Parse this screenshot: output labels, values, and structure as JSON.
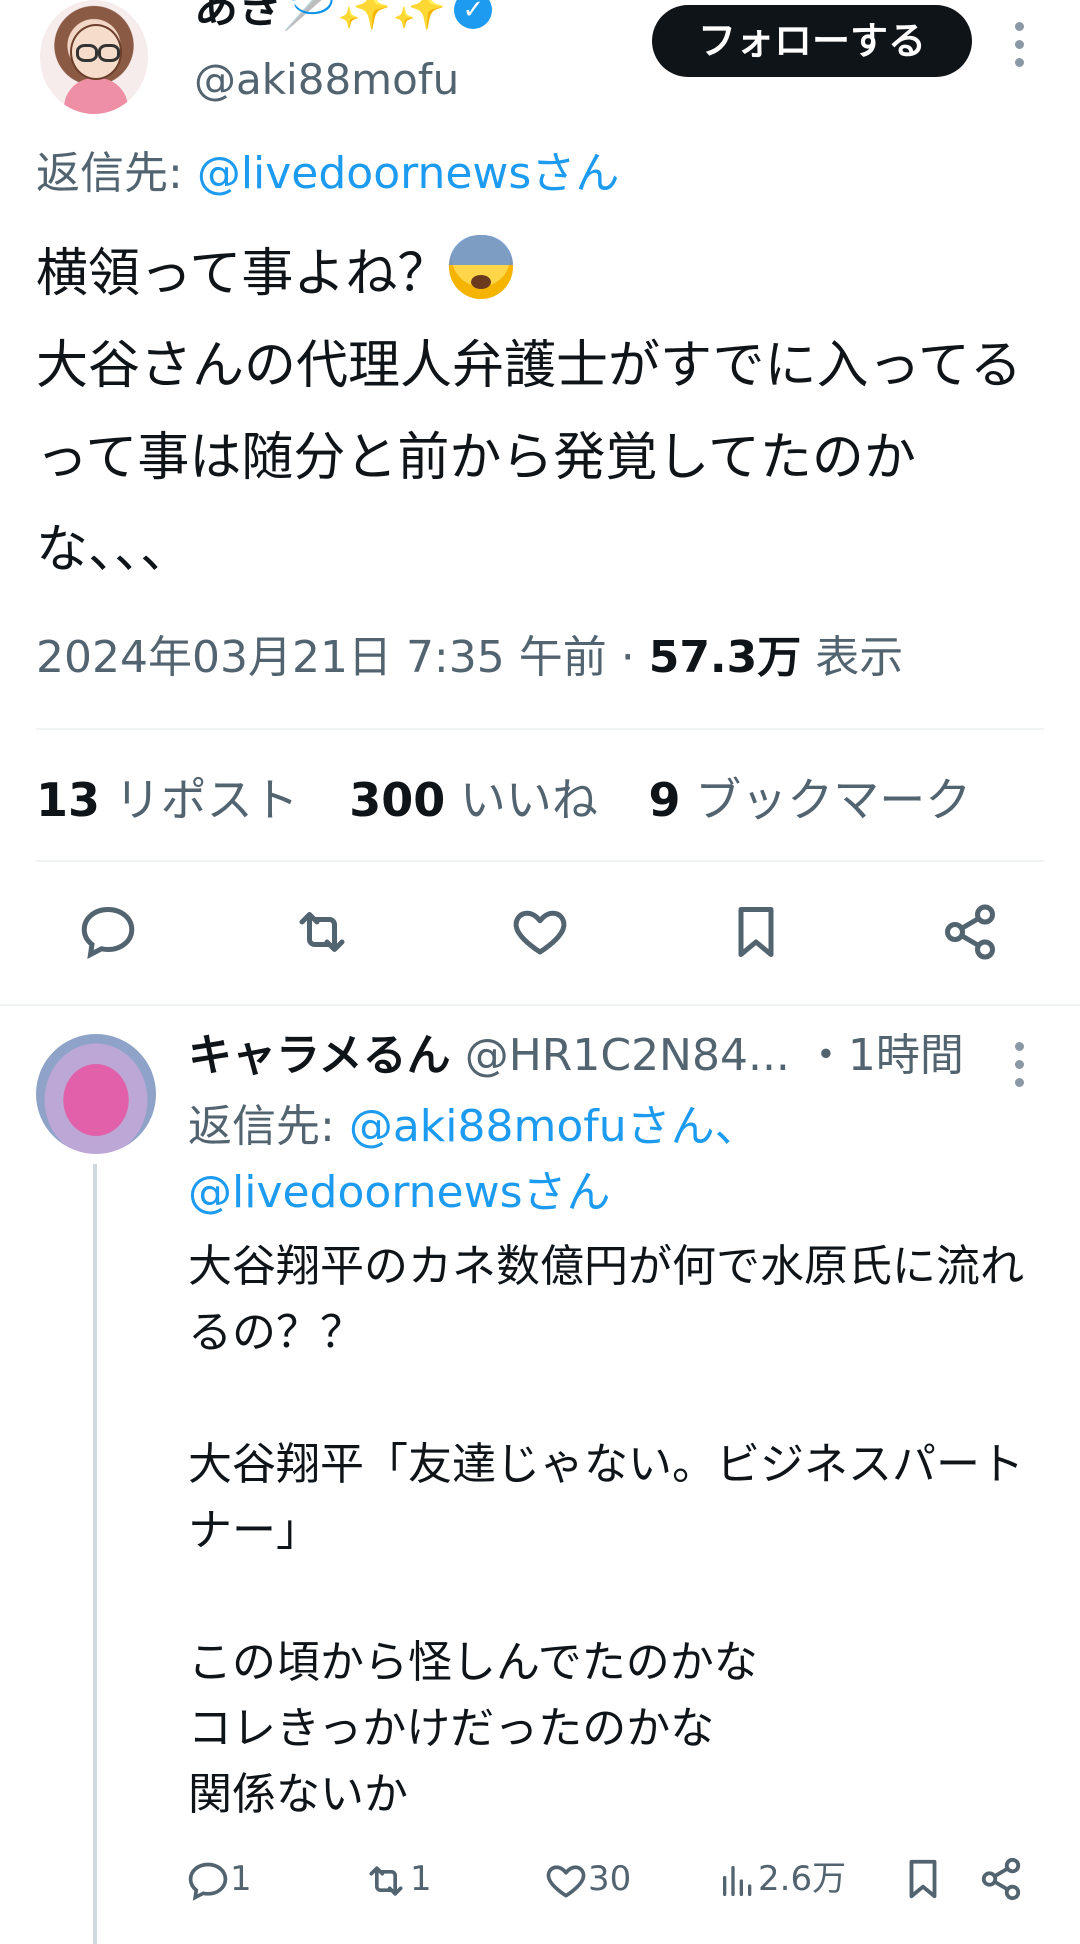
{
  "tweet": {
    "display_name": "あき🪡✨✨",
    "verified_badge": "verified-check-icon",
    "handle": "@aki88mofu",
    "follow_label": "フォローする",
    "reply_to_prefix": "返信先: ",
    "reply_to_handle": "@livedoornewsさん",
    "text_line1": "横領って事よね？",
    "text_rest": "大谷さんの代理人弁護士がすでに入ってるって事は随分と前から発覚してたのかな、、、",
    "timestamp": "2024年03月21日 7:35 午前 · ",
    "views_count": "57.3万",
    "views_label": " 表示",
    "stats": {
      "reposts_count": "13",
      "reposts_label": "リポスト",
      "likes_count": "300",
      "likes_label": "いいね",
      "bookmarks_count": "9",
      "bookmarks_label": "ブックマーク"
    }
  },
  "reply": {
    "display_name": "キャラメるん",
    "handle": "@HR1C2N84...",
    "time": "・1時間",
    "reply_to_prefix": "返信先: ",
    "reply_to_handle1": "@aki88mofuさん、",
    "reply_to_handle2": "@livedoornewsさん",
    "text": "大谷翔平のカネ数億円が何で水原氏に流れるの？？\n\n大谷翔平「友達じゃない。ビジネスパートナー」\n\nこの頃から怪しんでたのかな\nコレきっかけだったのかな\n関係ないか",
    "replies": "1",
    "reposts": "1",
    "likes": "30",
    "views": "2.6万"
  },
  "colors": {
    "accent": "#1d9bf0",
    "text": "#0f1419",
    "muted": "#536471",
    "divider": "#eff3f4"
  }
}
